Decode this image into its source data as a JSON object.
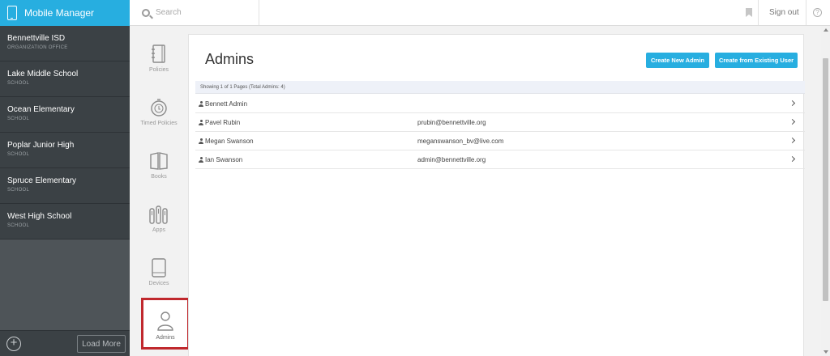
{
  "app": {
    "title": "Mobile Manager",
    "brand_color": "#27aee0",
    "highlight_color": "#c0282d"
  },
  "header": {
    "search_placeholder": "Search",
    "signout_label": "Sign out",
    "help_glyph": "?",
    "bookmark_icon": "bookmark-icon"
  },
  "organizations": [
    {
      "name": "Bennettville ISD",
      "type": "ORGANIZATION OFFICE"
    },
    {
      "name": "Lake Middle School",
      "type": "SCHOOL"
    },
    {
      "name": "Ocean Elementary",
      "type": "SCHOOL"
    },
    {
      "name": "Poplar Junior High",
      "type": "SCHOOL"
    },
    {
      "name": "Spruce Elementary",
      "type": "SCHOOL"
    },
    {
      "name": "West High School",
      "type": "SCHOOL"
    }
  ],
  "sidebar_footer": {
    "add_glyph": "+",
    "load_more_label": "Load More"
  },
  "rail": {
    "items": [
      {
        "label": "Policies",
        "icon": "notebook-icon"
      },
      {
        "label": "Timed Policies",
        "icon": "timer-icon"
      },
      {
        "label": "Books",
        "icon": "book-icon"
      },
      {
        "label": "Apps",
        "icon": "apps-icon"
      },
      {
        "label": "Devices",
        "icon": "tablet-icon"
      },
      {
        "label": "Admins",
        "icon": "person-icon",
        "active": true
      }
    ]
  },
  "main": {
    "title": "Admins",
    "create_new_label": "Create New Admin",
    "create_existing_label": "Create from Existing User",
    "summary": "Showing 1 of 1 Pages (Total Admins: 4)",
    "admins": [
      {
        "name": "Bennett Admin",
        "email": ""
      },
      {
        "name": "Pavel Rubin",
        "email": "prubin@bennettville.org"
      },
      {
        "name": "Megan Swanson",
        "email": "meganswanson_bv@live.com"
      },
      {
        "name": "Ian Swanson",
        "email": "admin@bennettville.org"
      }
    ]
  }
}
